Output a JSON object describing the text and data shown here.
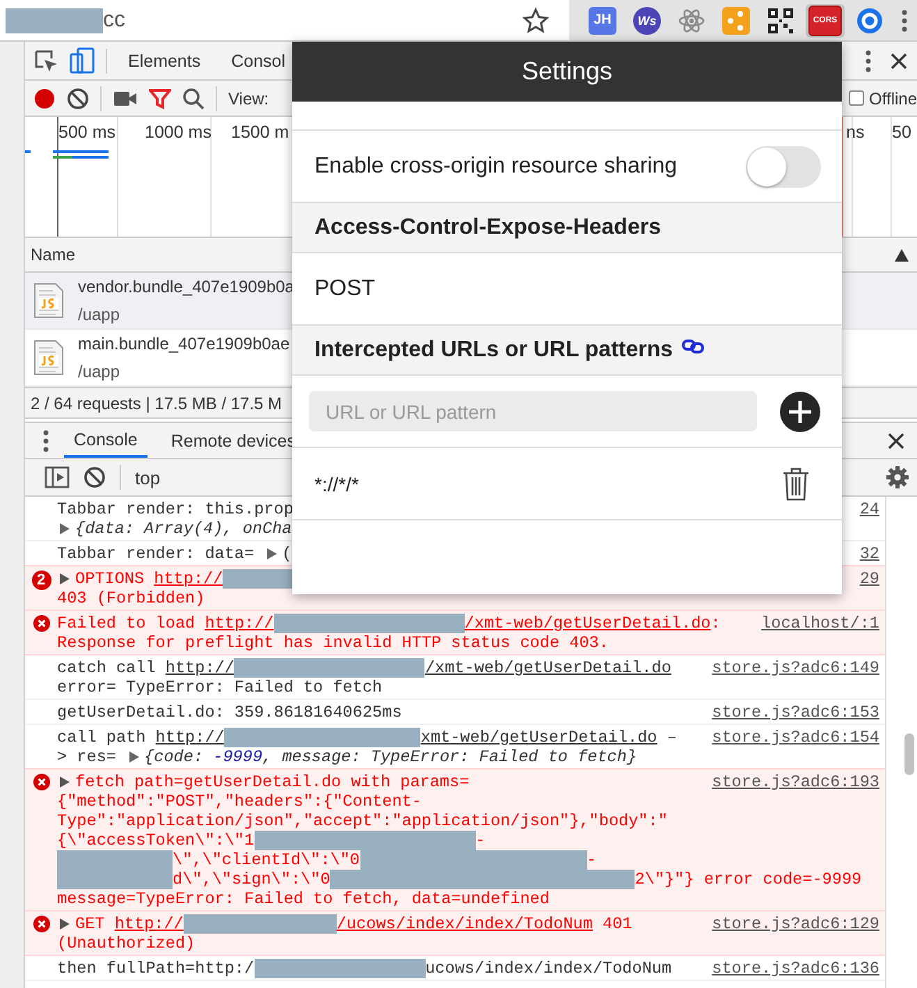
{
  "browser": {
    "address": [
      {
        "kind": "redacted"
      },
      {
        "kind": "text",
        "text": "cc"
      }
    ],
    "extensions": [
      {
        "kind": "jh",
        "label": "JH",
        "selected": false
      },
      {
        "kind": "ws",
        "label": "Ws",
        "selected": false
      },
      {
        "kind": "atom",
        "selected": false
      },
      {
        "kind": "share",
        "selected": false
      },
      {
        "kind": "qr",
        "selected": false
      },
      {
        "kind": "cors",
        "label": "CORS",
        "selected": true
      },
      {
        "kind": "ring",
        "selected": false
      }
    ]
  },
  "network": {
    "tabs": [
      {
        "label": "Elements",
        "selected": false
      },
      {
        "label": "Consol",
        "selected": false
      }
    ],
    "recording": true,
    "filter_active": true,
    "view_label": "View:",
    "offline": {
      "label": "Offline",
      "checked": false
    },
    "timeline_ticks": [
      "500 ms",
      "1000 ms",
      "1500 m",
      "ns",
      "50"
    ],
    "columns": [
      "Name"
    ],
    "requests": [
      {
        "name": "vendor.bundle_407e1909b0a",
        "path": "/uapp",
        "selected": true
      },
      {
        "name": "main.bundle_407e1909b0ae",
        "path": "/uapp",
        "selected": false
      }
    ],
    "summary": "2 / 64 requests | 17.5 MB / 17.5 M"
  },
  "console": {
    "tabs": [
      {
        "label": "Console",
        "selected": true
      },
      {
        "label": "Remote devices",
        "selected": false
      }
    ],
    "context": "top",
    "messages": [
      {
        "kind": "log",
        "source": "24",
        "lines": [
          [
            {
              "kind": "text",
              "text": "Tabbar render: this.prop"
            }
          ],
          [
            {
              "kind": "arrow"
            },
            {
              "kind": "object",
              "text": "{data: Array(4), onCha"
            }
          ]
        ]
      },
      {
        "kind": "log",
        "source": "32",
        "lines": [
          [
            {
              "kind": "text",
              "text": "Tabbar render: data= "
            },
            {
              "kind": "arrow"
            },
            {
              "kind": "text",
              "text": "("
            }
          ]
        ]
      },
      {
        "kind": "error",
        "count": "2",
        "source": "29",
        "lines": [
          [
            {
              "kind": "arrow"
            },
            {
              "kind": "text",
              "text": "OPTIONS "
            },
            {
              "kind": "link",
              "text": "http://"
            },
            {
              "kind": "redacted"
            }
          ],
          [
            {
              "kind": "text",
              "text": "403 (Forbidden)"
            }
          ]
        ]
      },
      {
        "kind": "error",
        "source": "localhost/:1",
        "lines": [
          [
            {
              "kind": "text",
              "text": "Failed to load "
            },
            {
              "kind": "link",
              "text": "http://"
            },
            {
              "kind": "redacted"
            },
            {
              "kind": "link",
              "text": "/xmt-web/getUserDetail.do"
            },
            {
              "kind": "text",
              "text": ":"
            }
          ],
          [
            {
              "kind": "text",
              "text": "Response for preflight has invalid HTTP status code 403."
            }
          ]
        ]
      },
      {
        "kind": "log",
        "source": "store.js?adc6:149",
        "lines": [
          [
            {
              "kind": "text",
              "text": "catch call "
            },
            {
              "kind": "link",
              "text": "http://"
            },
            {
              "kind": "redacted"
            },
            {
              "kind": "link",
              "text": "/xmt-web/getUserDetail.do"
            }
          ],
          [
            {
              "kind": "text",
              "text": "error= TypeError: Failed to fetch"
            }
          ]
        ]
      },
      {
        "kind": "log",
        "source": "store.js?adc6:153",
        "lines": [
          [
            {
              "kind": "text",
              "text": "getUserDetail.do: 359.86181640625ms"
            }
          ]
        ]
      },
      {
        "kind": "log",
        "source": "store.js?adc6:154",
        "lines": [
          [
            {
              "kind": "text",
              "text": "call path "
            },
            {
              "kind": "link",
              "text": "http://"
            },
            {
              "kind": "redacted"
            },
            {
              "kind": "link",
              "text": "xmt-web/getUserDetail.do"
            },
            {
              "kind": "text",
              "text": " –"
            }
          ],
          [
            {
              "kind": "text",
              "text": "> res= "
            },
            {
              "kind": "arrow"
            },
            {
              "kind": "object",
              "text": "{code: "
            },
            {
              "kind": "number",
              "text": "-9999"
            },
            {
              "kind": "object",
              "text": ", message: TypeError: Failed to fetch}"
            }
          ]
        ]
      },
      {
        "kind": "error",
        "source": "store.js?adc6:193",
        "lines": [
          [
            {
              "kind": "arrow"
            },
            {
              "kind": "text",
              "text": "fetch path=getUserDetail.do with params="
            }
          ],
          [
            {
              "kind": "text",
              "text": "{\"method\":\"POST\",\"headers\":{\"Content-"
            }
          ],
          [
            {
              "kind": "text",
              "text": "Type\":\"application/json\",\"accept\":\"application/json\"},\"body\":\""
            }
          ],
          [
            {
              "kind": "text",
              "text": "{\\\"accessToken\\\":\\\"1"
            },
            {
              "kind": "redacted"
            },
            {
              "kind": "text",
              "text": "-"
            }
          ],
          [
            {
              "kind": "redacted"
            },
            {
              "kind": "text",
              "text": "\\\",\\\"clientId\\\":\\\"0"
            },
            {
              "kind": "redacted"
            },
            {
              "kind": "text",
              "text": "-"
            }
          ],
          [
            {
              "kind": "redacted"
            },
            {
              "kind": "text",
              "text": "d\\\",\\\"sign\\\":\\\"0"
            },
            {
              "kind": "redacted"
            },
            {
              "kind": "text",
              "text": "2\\\"}\"} error code=-9999"
            }
          ],
          [
            {
              "kind": "text",
              "text": "message=TypeError: Failed to fetch, data=undefined"
            }
          ]
        ]
      },
      {
        "kind": "error",
        "source": "store.js?adc6:129",
        "lines": [
          [
            {
              "kind": "arrow"
            },
            {
              "kind": "text",
              "text": "GET "
            },
            {
              "kind": "link",
              "text": "http://"
            },
            {
              "kind": "redacted"
            },
            {
              "kind": "link",
              "text": "/ucows/index/index/TodoNum"
            },
            {
              "kind": "text",
              "text": " 401"
            }
          ],
          [
            {
              "kind": "text",
              "text": "(Unauthorized)"
            }
          ]
        ]
      },
      {
        "kind": "log",
        "source": "store.js?adc6:136",
        "lines": [
          [
            {
              "kind": "text",
              "text": "then fullPath=http:/"
            },
            {
              "kind": "redacted"
            },
            {
              "kind": "text",
              "text": "ucows/index/index/TodoNum"
            }
          ]
        ]
      }
    ]
  },
  "settings": {
    "title": "Settings",
    "cors": {
      "label": "Enable cross-origin resource sharing",
      "on": false
    },
    "expose_headers": {
      "heading": "Access-Control-Expose-Headers",
      "value": "POST"
    },
    "patterns": {
      "heading": "Intercepted URLs or URL patterns",
      "placeholder": "URL or URL pattern",
      "items": [
        "*://*/*"
      ]
    }
  }
}
